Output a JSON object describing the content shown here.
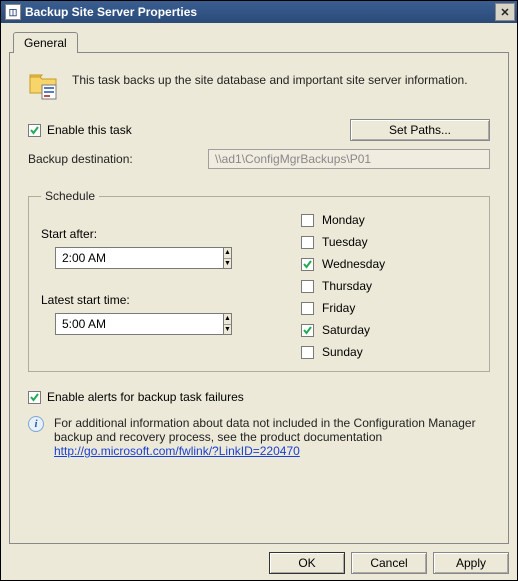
{
  "window": {
    "title": "Backup Site Server Properties"
  },
  "tab": {
    "general": "General"
  },
  "description": "This task backs up the site database and important site server information.",
  "enable_task": {
    "label": "Enable this task",
    "checked": true
  },
  "set_paths_label": "Set Paths...",
  "destination": {
    "label": "Backup destination:",
    "value": "\\\\ad1\\ConfigMgrBackups\\P01"
  },
  "schedule": {
    "legend": "Schedule",
    "start_after": {
      "label": "Start after:",
      "value": "2:00 AM"
    },
    "latest_start": {
      "label": "Latest start time:",
      "value": "5:00 AM"
    },
    "days": [
      {
        "name": "Monday",
        "checked": false
      },
      {
        "name": "Tuesday",
        "checked": false
      },
      {
        "name": "Wednesday",
        "checked": true
      },
      {
        "name": "Thursday",
        "checked": false
      },
      {
        "name": "Friday",
        "checked": false
      },
      {
        "name": "Saturday",
        "checked": true
      },
      {
        "name": "Sunday",
        "checked": false
      }
    ]
  },
  "enable_alerts": {
    "label": "Enable alerts for backup task failures",
    "checked": true
  },
  "info": {
    "text": "For additional information about data not included in the Configuration Manager backup and recovery process, see the product documentation",
    "link": "http://go.microsoft.com/fwlink/?LinkID=220470"
  },
  "buttons": {
    "ok": "OK",
    "cancel": "Cancel",
    "apply": "Apply"
  }
}
